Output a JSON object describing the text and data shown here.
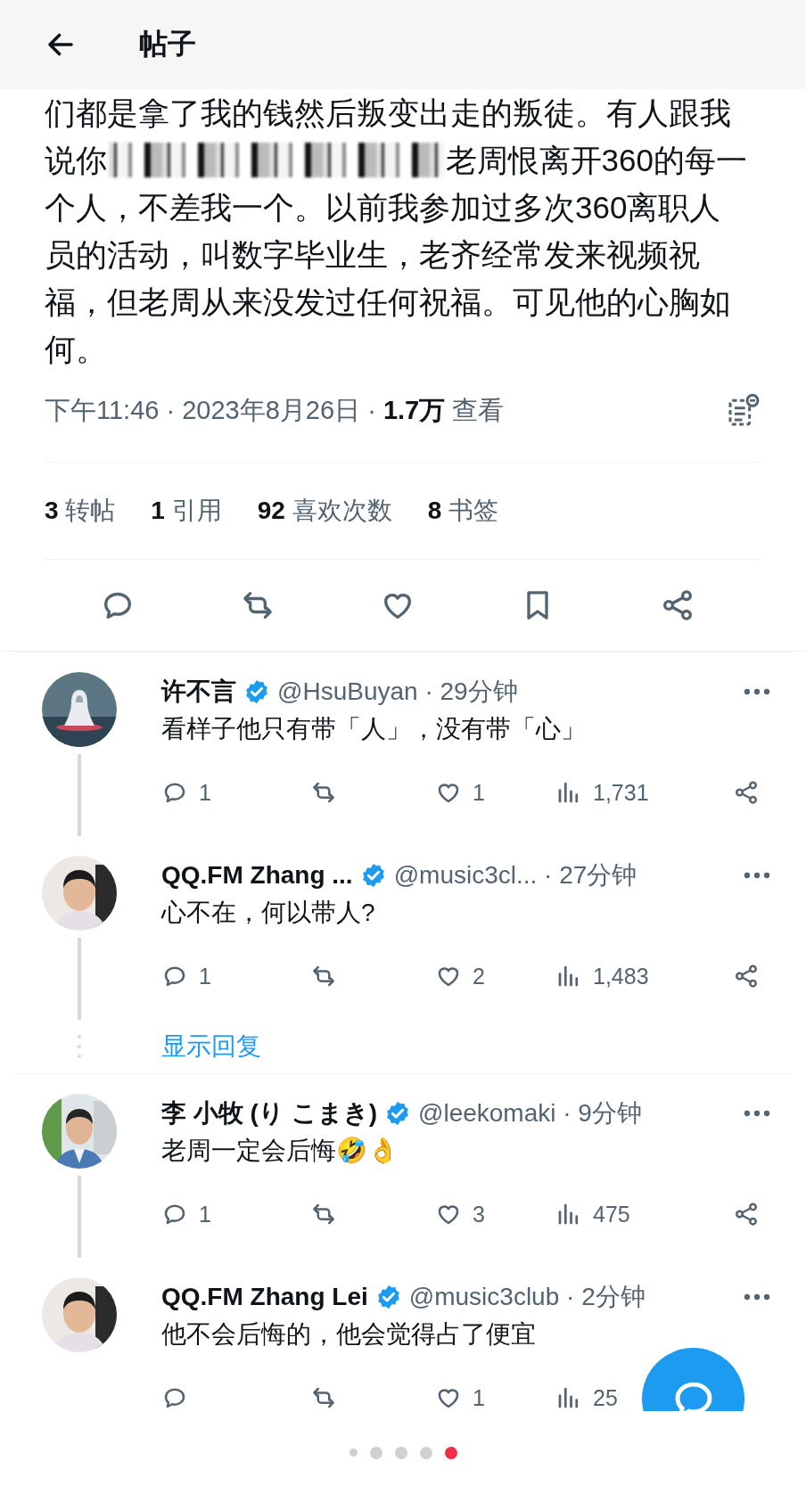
{
  "header": {
    "title": "帖子"
  },
  "post": {
    "lines": [
      {
        "parts": [
          {
            "kind": "text",
            "text": "们都是拿了我的钱然后叛变出走的叛徒。有人跟我"
          }
        ]
      },
      {
        "parts": [
          {
            "kind": "text",
            "text": "说你"
          },
          {
            "kind": "redaction"
          },
          {
            "kind": "text",
            "text": "老周恨离开360的每一"
          }
        ]
      },
      {
        "parts": [
          {
            "kind": "text",
            "text": "个人，不差我一个。以前我参加过多次360离职人员的活动，叫数字毕业生，老齐经常发来视频祝福，但老周从来没发过任何祝福。可见他的心胸如何。"
          }
        ]
      }
    ],
    "meta": "下午11:46 · 2023年8月26日 · **1.7万** 查看"
  },
  "stats": [
    {
      "text": "**3** 转帖"
    },
    {
      "text": "**1** 引用"
    },
    {
      "text": "**92** 喜欢次数"
    },
    {
      "text": "**8** 书签"
    }
  ],
  "actions": [
    {
      "kind": "reply"
    },
    {
      "kind": "repost"
    },
    {
      "kind": "like"
    },
    {
      "kind": "bookmark"
    },
    {
      "kind": "share"
    }
  ],
  "threads": [
    {
      "replies": [
        {
          "name": "许不言",
          "verified": true,
          "handle": "@HsuBuyan",
          "time": " · 29分钟",
          "text": "看样子他只有带「人」，没有带「心」",
          "metrics": [
            {
              "kind": "reply",
              "count": "1"
            },
            {
              "kind": "repost"
            },
            {
              "kind": "like",
              "count": "1"
            },
            {
              "kind": "views",
              "count": "1,731"
            },
            {
              "kind": "share"
            }
          ]
        },
        {
          "name": "QQ.FM Zhang ...",
          "verified": true,
          "handle": "@music3cl...",
          "time": " · 27分钟",
          "text": "心不在，何以带人?",
          "metrics": [
            {
              "kind": "reply",
              "count": "1"
            },
            {
              "kind": "repost"
            },
            {
              "kind": "like",
              "count": "2"
            },
            {
              "kind": "views",
              "count": "1,483"
            },
            {
              "kind": "share"
            }
          ]
        }
      ],
      "show_replies": "显示回复"
    },
    {
      "replies": [
        {
          "name": "李 小牧 (り こまき)",
          "verified": true,
          "handle": "@leekomaki",
          "time": " · 9分钟",
          "text": "老周一定会后悔🤣👌",
          "metrics": [
            {
              "kind": "reply",
              "count": "1"
            },
            {
              "kind": "repost"
            },
            {
              "kind": "like",
              "count": "3"
            },
            {
              "kind": "views",
              "count": "475"
            },
            {
              "kind": "share"
            }
          ]
        },
        {
          "name": "QQ.FM Zhang Lei",
          "verified": true,
          "handle": "@music3club",
          "time": " · 2分钟",
          "text": "他不会后悔的，他会觉得占了便宜",
          "metrics": [
            {
              "kind": "reply"
            },
            {
              "kind": "repost"
            },
            {
              "kind": "like",
              "count": "1"
            },
            {
              "kind": "views",
              "count": "25"
            }
          ]
        }
      ]
    }
  ],
  "fab": {
    "kind": "compose"
  },
  "pager": [
    {
      "selected": false
    },
    {
      "selected": false
    },
    {
      "selected": false
    },
    {
      "selected": false
    },
    {
      "selected": true
    }
  ]
}
